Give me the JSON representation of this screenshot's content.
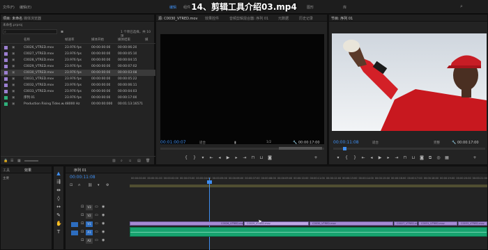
{
  "title": "14、剪辑工具介绍03.mp4",
  "menu": {
    "file": "文件(F)",
    "edit": "编辑(E)"
  },
  "workspace_tabs": [
    "编辑",
    "组件",
    "效果",
    "音频",
    "图形",
    "库"
  ],
  "project_panel": {
    "tabs": [
      "项目: 未命名",
      "媒体浏览器"
    ],
    "project_file": "未命名.prproj",
    "search_placeholder": "",
    "item_count": "1 个项已选择，共 10 项",
    "columns": [
      "名称",
      "帧速率",
      "媒体开始",
      "媒体结束",
      "媒"
    ],
    "items": [
      {
        "name": "C0026_VTRED.mov",
        "fps": "23.976 fps",
        "start": "00:00:00:00",
        "end": "00:00:06:20",
        "color": "#9c7fd1"
      },
      {
        "name": "C0027_VTRED.mov",
        "fps": "23.976 fps",
        "start": "00:00:00:00",
        "end": "00:00:05:10",
        "color": "#9c7fd1"
      },
      {
        "name": "C0028_VTRED.mov",
        "fps": "23.976 fps",
        "start": "00:00:00:00",
        "end": "00:00:04:15",
        "color": "#9c7fd1"
      },
      {
        "name": "C0029_VTRED.mov",
        "fps": "23.976 fps",
        "start": "00:00:00:00",
        "end": "00:00:07:02",
        "color": "#9c7fd1"
      },
      {
        "name": "C0030_VTRED.mov",
        "fps": "23.976 fps",
        "start": "00:00:00:00",
        "end": "00:00:03:08",
        "color": "#9c7fd1",
        "selected": true
      },
      {
        "name": "C0031_VTRED.mov",
        "fps": "23.976 fps",
        "start": "00:00:00:00",
        "end": "00:00:05:22",
        "color": "#9c7fd1"
      },
      {
        "name": "C0032_VTRED.mov",
        "fps": "23.976 fps",
        "start": "00:00:00:00",
        "end": "00:00:06:11",
        "color": "#9c7fd1"
      },
      {
        "name": "C0033_VTRED.mov",
        "fps": "23.976 fps",
        "start": "00:00:00:00",
        "end": "00:00:04:03",
        "color": "#9c7fd1"
      },
      {
        "name": "序列 01",
        "fps": "23.976 fps",
        "start": "00:00:00:00",
        "end": "00:00:17:00",
        "color": "#2fb07b"
      },
      {
        "name": "Production Rising Tides.wav",
        "fps": "48000 Hz",
        "start": "00:00:00:000",
        "end": "00:01:13:16571",
        "color": "#2fb07b"
      }
    ]
  },
  "source_panel": {
    "tabs": [
      "源: C0030_VTRED.mov",
      "效果控件",
      "音频剪辑混合器: 序列 01",
      "元数据",
      "历史记录"
    ],
    "timecode": "00:01:00:07",
    "fit": "适合",
    "ratio": "1/2",
    "duration": "00:00:17:00"
  },
  "program_panel": {
    "tabs": [
      "节目: 序列 01"
    ],
    "timecode": "00:00:11:08",
    "fit": "适合",
    "ratio": "完整",
    "duration": "00:00:17:00"
  },
  "effects_panel": {
    "tabs": [
      "工具",
      "效果"
    ],
    "label": "主要"
  },
  "timeline": {
    "tab": "序列 01",
    "timecode": "00:00:11:08",
    "ruler": [
      "00:00:00:00",
      "00:00:01:00",
      "00:00:02:00",
      "00:00:03:00",
      "00:00:04:00",
      "00:00:05:00",
      "00:00:06:00",
      "00:00:07:00",
      "00:00:08:00",
      "00:00:09:00",
      "00:00:10:00",
      "00:00:11:00",
      "00:00:12:00",
      "00:00:13:00",
      "00:00:14:00",
      "00:00:15:00",
      "00:00:16:00",
      "00:00:17:00",
      "00:00:18:00",
      "00:00:19:00",
      "00:00:20:00",
      "00:00:21:00"
    ],
    "tracks": [
      "V3",
      "V2",
      "V1",
      "A1",
      "A2"
    ],
    "clips": [
      "C0026_VTRED.mov",
      "C0029_VTRED.mov",
      "C0030_VTRED.mov",
      "C0027_VTRED.mov",
      "C0031_VTRED.mov",
      "C0033_VTRED.mov"
    ]
  },
  "colors": {
    "accent": "#3f8ef0",
    "video_clip": "#a58bd3",
    "audio_clip": "#17a36f"
  }
}
